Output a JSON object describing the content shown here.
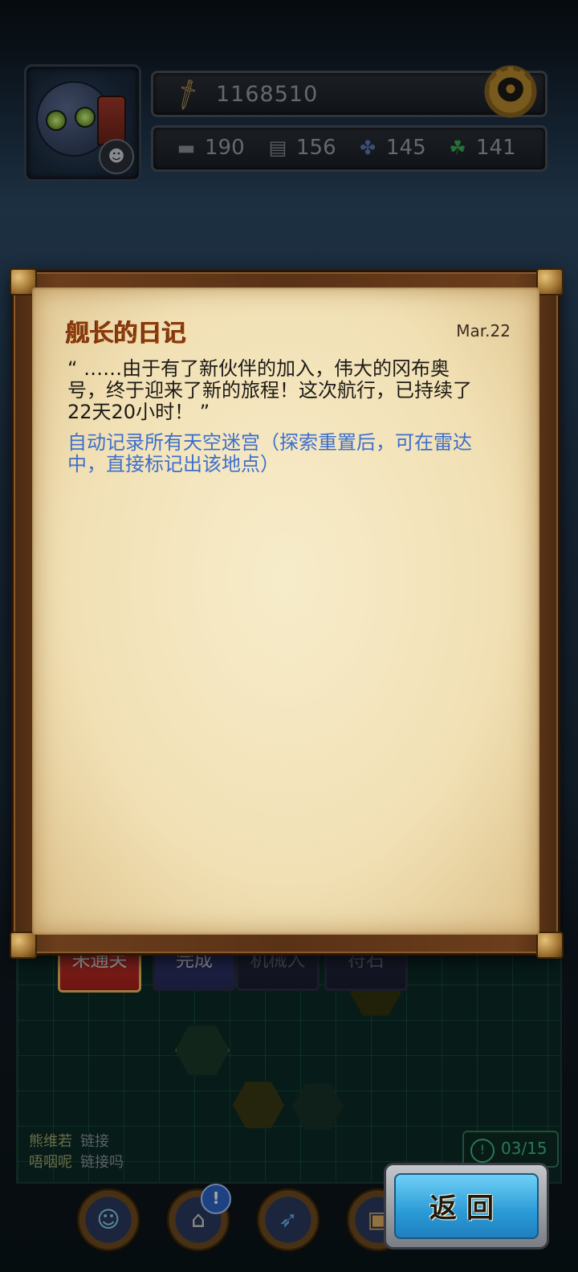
{
  "player": {
    "power": "1168510",
    "resources": [
      {
        "icon": "anvil-icon",
        "value": "190"
      },
      {
        "icon": "scroll-icon",
        "value": "156"
      },
      {
        "icon": "propeller-icon",
        "value": "145"
      },
      {
        "icon": "clover-icon",
        "value": "141"
      }
    ]
  },
  "tabs": [
    "未通关",
    "完成",
    "机械人",
    "符石"
  ],
  "chat": [
    {
      "name": "熊维若",
      "link": "链接"
    },
    {
      "name": "唔咽呢",
      "link": "链接吗"
    }
  ],
  "counter": "03/15",
  "notification_badge": "!",
  "back_button": "返回",
  "diary": {
    "title": "舰长的日记",
    "date": "Mar.22",
    "text": "“ ……由于有了新伙伴的加入，伟大的冈布奥号，终于迎来了新的旅程！这次航行，已持续了22天20小时！ ”",
    "note": "自动记录所有天空迷宫（探索重置后，可在雷达中，直接标记出该地点）"
  },
  "colors": {
    "note_blue": "#3d6fcc",
    "title_brown": "#8a3a12",
    "active_tab_red": "#c4302a",
    "back_button_blue": "#2a9ad6"
  }
}
